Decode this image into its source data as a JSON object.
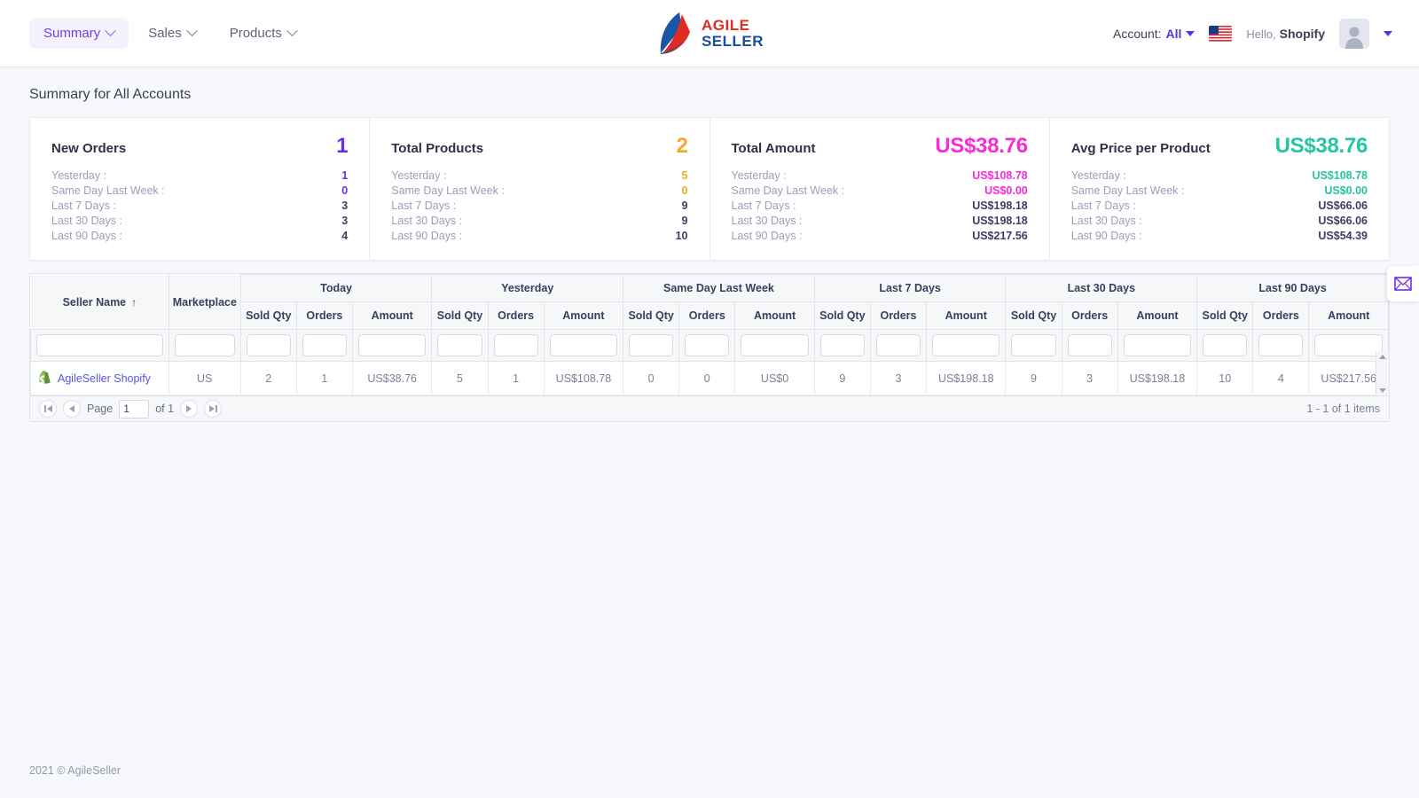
{
  "nav": {
    "items": [
      {
        "label": "Summary",
        "active": true
      },
      {
        "label": "Sales",
        "active": false
      },
      {
        "label": "Products",
        "active": false
      }
    ]
  },
  "brand": {
    "line1": "AGILE",
    "line2": "SELLER",
    "logo_blue": "#1a4fa0",
    "logo_red": "#e02b20"
  },
  "account": {
    "prefix": "Account:",
    "value": "All"
  },
  "user": {
    "greeting": "Hello,",
    "name": "Shopify"
  },
  "page": {
    "title": "Summary for All Accounts"
  },
  "cards": [
    {
      "title": "New Orders",
      "value": "1",
      "color": "#6c2bf5",
      "rows": [
        {
          "label": "Yesterday :",
          "value": "1",
          "accent": true
        },
        {
          "label": "Same Day Last Week :",
          "value": "0",
          "accent": true
        },
        {
          "label": "Last 7 Days :",
          "value": "3",
          "accent": false
        },
        {
          "label": "Last 30 Days :",
          "value": "3",
          "accent": false
        },
        {
          "label": "Last 90 Days :",
          "value": "4",
          "accent": false
        }
      ]
    },
    {
      "title": "Total Products",
      "value": "2",
      "color": "#f7a823",
      "rows": [
        {
          "label": "Yesterday :",
          "value": "5",
          "accent": true
        },
        {
          "label": "Same Day Last Week :",
          "value": "0",
          "accent": true
        },
        {
          "label": "Last 7 Days :",
          "value": "9",
          "accent": false
        },
        {
          "label": "Last 30 Days :",
          "value": "9",
          "accent": false
        },
        {
          "label": "Last 90 Days :",
          "value": "10",
          "accent": false
        }
      ]
    },
    {
      "title": "Total Amount",
      "value": "US$38.76",
      "color": "#f72bd8",
      "rows": [
        {
          "label": "Yesterday :",
          "value": "US$108.78",
          "accent": true
        },
        {
          "label": "Same Day Last Week :",
          "value": "US$0.00",
          "accent": true
        },
        {
          "label": "Last 7 Days :",
          "value": "US$198.18",
          "accent": false
        },
        {
          "label": "Last 30 Days :",
          "value": "US$198.18",
          "accent": false
        },
        {
          "label": "Last 90 Days :",
          "value": "US$217.56",
          "accent": false
        }
      ]
    },
    {
      "title": "Avg Price per Product",
      "value": "US$38.76",
      "color": "#22c6a0",
      "rows": [
        {
          "label": "Yesterday :",
          "value": "US$108.78",
          "accent": true
        },
        {
          "label": "Same Day Last Week :",
          "value": "US$0.00",
          "accent": true
        },
        {
          "label": "Last 7 Days :",
          "value": "US$66.06",
          "accent": false
        },
        {
          "label": "Last 30 Days :",
          "value": "US$66.06",
          "accent": false
        },
        {
          "label": "Last 90 Days :",
          "value": "US$54.39",
          "accent": false
        }
      ]
    }
  ],
  "table": {
    "group_headers": [
      "Today",
      "Yesterday",
      "Same Day Last Week",
      "Last 7 Days",
      "Last 30 Days",
      "Last 90 Days"
    ],
    "fixed_headers": [
      "Seller Name",
      "Marketplace"
    ],
    "sort_indicator": "↑",
    "metric_headers": [
      "Sold Qty",
      "Orders",
      "Amount"
    ],
    "rows": [
      {
        "seller": "AgileSeller Shopify",
        "marketplace": "US",
        "cells": [
          "2",
          "1",
          "US$38.76",
          "5",
          "1",
          "US$108.78",
          "0",
          "0",
          "US$0",
          "9",
          "3",
          "US$198.18",
          "9",
          "3",
          "US$198.18",
          "10",
          "4",
          "US$217.56"
        ]
      }
    ]
  },
  "pager": {
    "page_label": "Page",
    "page_value": "1",
    "of_label": "of 1",
    "items_label": "1 - 1 of 1 items"
  },
  "footer": {
    "text": "2021 © AgileSeller"
  }
}
